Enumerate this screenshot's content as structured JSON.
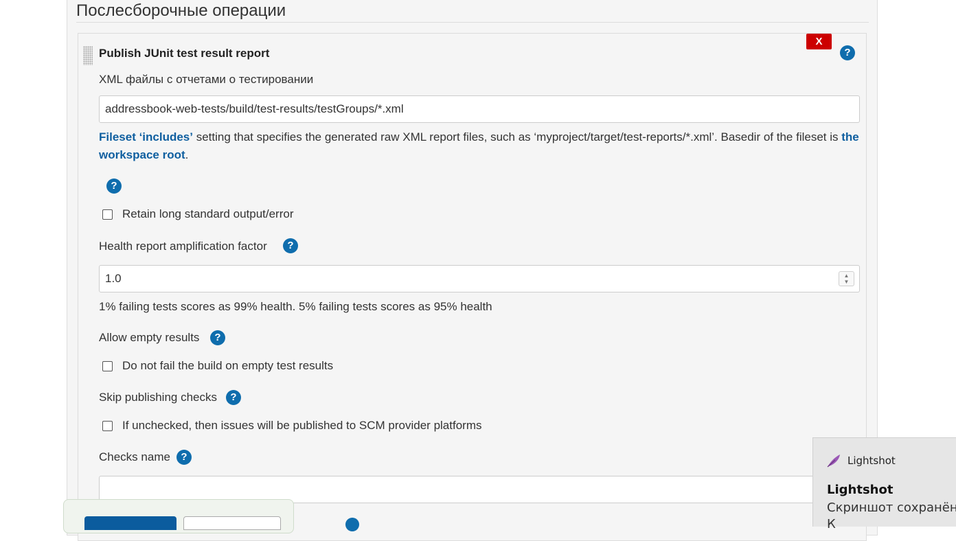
{
  "section": {
    "title": "Послесборочные операции"
  },
  "step": {
    "title": "Publish JUnit test result report",
    "delete_label": "X",
    "help_glyph": "?"
  },
  "xml_field": {
    "label": "XML файлы с отчетами о тестировании",
    "value": "addressbook-web-tests/build/test-results/testGroups/*.xml",
    "desc_link1": "Fileset ‘includes’",
    "desc_text": " setting that specifies the generated raw XML report files, such as ‘myproject/target/test-reports/*.xml’. Basedir of the fileset is ",
    "desc_link2": "the workspace root",
    "desc_end": "."
  },
  "retain_output": {
    "label": "Retain long standard output/error",
    "checked": false
  },
  "health_factor": {
    "label": "Health report amplification factor",
    "value": "1.0",
    "desc": "1% failing tests scores as 99% health. 5% failing tests scores as 95% health"
  },
  "allow_empty": {
    "label": "Allow empty results",
    "checkbox_label": "Do not fail the build on empty test results",
    "checked": false
  },
  "skip_checks": {
    "label": "Skip publishing checks",
    "checkbox_label": "If unchecked, then issues will be published to SCM provider platforms",
    "checked": false
  },
  "checks_name": {
    "label": "Checks name",
    "value": ""
  },
  "toast": {
    "app": "Lightshot",
    "title": "Lightshot",
    "message": "Скриншот сохранён в",
    "message_line2": "К"
  },
  "colors": {
    "help": "#0f6dad",
    "delete": "#cc0000",
    "link": "#0f5fa0",
    "save": "#0b5c9e",
    "toast_bg": "#e6e6e6"
  },
  "icons": [
    "drag-handle",
    "help-icon",
    "close-icon",
    "spinner-icon",
    "feather-icon"
  ]
}
